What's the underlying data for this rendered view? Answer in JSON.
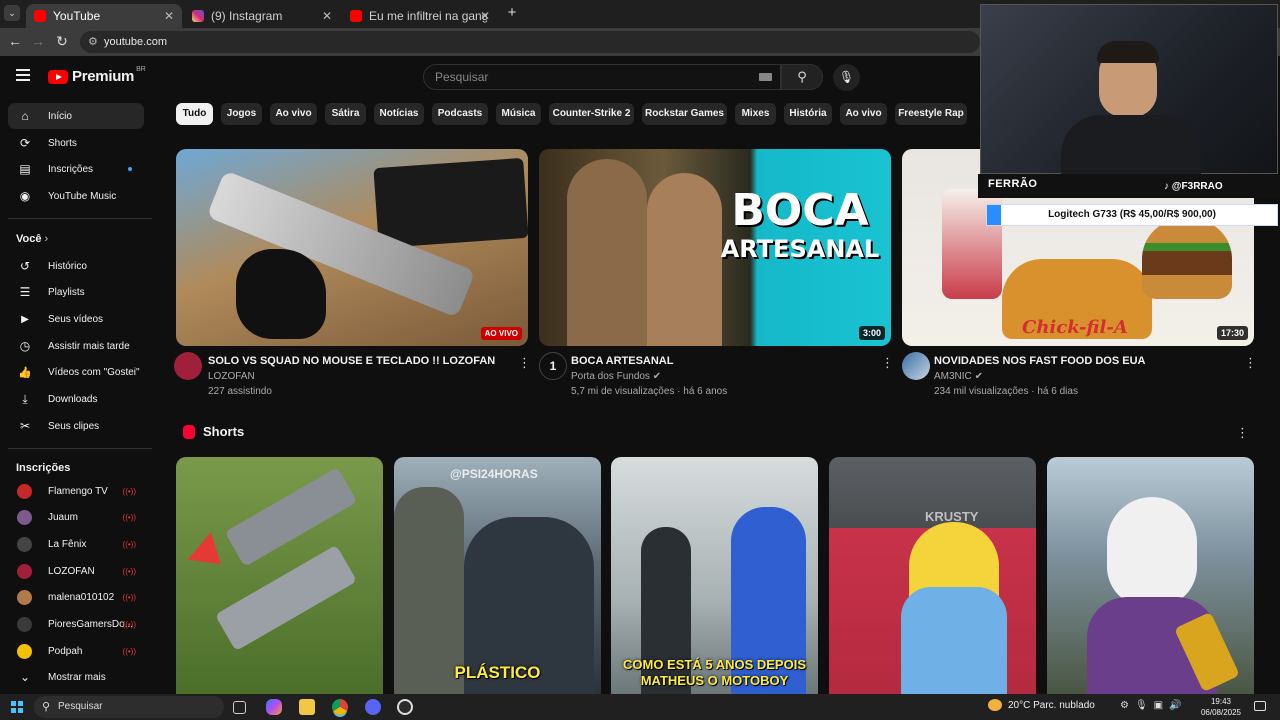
{
  "browser": {
    "tabs": [
      {
        "title": "YouTube",
        "color": "#ff0000"
      },
      {
        "title": "(9) Instagram",
        "color": "#d62976"
      },
      {
        "title": "Eu me infiltrei na gangue mais ...",
        "color": "#ff0000"
      }
    ],
    "new_tab": "+",
    "url": "youtube.com"
  },
  "header": {
    "logo": "Premium",
    "country": "BR",
    "search_placeholder": "Pesquisar"
  },
  "sidebar": {
    "main": [
      {
        "label": "Início",
        "icon": "home-icon",
        "glyph": "⌂"
      },
      {
        "label": "Shorts",
        "icon": "shorts-icon",
        "glyph": "⟳"
      },
      {
        "label": "Inscrições",
        "icon": "subscriptions-icon",
        "glyph": "▤"
      },
      {
        "label": "YouTube Music",
        "icon": "music-icon",
        "glyph": "◉"
      }
    ],
    "you_title": "Você",
    "you": [
      {
        "label": "Histórico",
        "icon": "history-icon",
        "glyph": "↺"
      },
      {
        "label": "Playlists",
        "icon": "playlists-icon",
        "glyph": "☰"
      },
      {
        "label": "Seus vídeos",
        "icon": "your-videos-icon",
        "glyph": "▶"
      },
      {
        "label": "Assistir mais tarde",
        "icon": "watch-later-icon",
        "glyph": "◷"
      },
      {
        "label": "Vídeos com \"Gostei\"",
        "icon": "like-icon",
        "glyph": "👍"
      },
      {
        "label": "Downloads",
        "icon": "download-icon",
        "glyph": "⤓"
      },
      {
        "label": "Seus clipes",
        "icon": "clips-icon",
        "glyph": "✂"
      }
    ],
    "subs_title": "Inscrições",
    "subs": [
      {
        "label": "Flamengo TV",
        "color": "#c62828"
      },
      {
        "label": "Juaum",
        "color": "#7b5a8c"
      },
      {
        "label": "La Fênix",
        "color": "#444444"
      },
      {
        "label": "LOZOFAN",
        "color": "#a0203c"
      },
      {
        "label": "malena010102",
        "color": "#b07a4a"
      },
      {
        "label": "PioresGamersDo...",
        "color": "#3a3a3a"
      },
      {
        "label": "Podpah",
        "color": "#f2c200"
      }
    ],
    "show_more": "Mostrar mais"
  },
  "chips": [
    "Tudo",
    "Jogos",
    "Ao vivo",
    "Sátira",
    "Notícias",
    "Podcasts",
    "Música",
    "Counter-Strike 2",
    "Rockstar Games",
    "Mixes",
    "História",
    "Ao vivo",
    "Freestyle Rap"
  ],
  "videos": [
    {
      "title": "SOLO VS SQUAD NO MOUSE E TECLADO !! LOZOFAN",
      "channel": "LOZOFAN",
      "meta": "227 assistindo",
      "badge": "AO VIVO",
      "thumb_text": ""
    },
    {
      "title": "BOCA ARTESANAL",
      "channel": "Porta dos Fundos",
      "meta": "5,7 mi de visualizações · há 6 anos",
      "badge": "3:00",
      "thumb_text": "BOCA",
      "thumb_text2": "ARTESANAL"
    },
    {
      "title": "NOVIDADES NOS FAST FOOD DOS EUA",
      "channel": "AM3NIC",
      "meta": "234 mil visualizações · há 6 dias",
      "badge": "17:30",
      "thumb_text": "Chick-fil-A"
    }
  ],
  "shorts": {
    "title": "Shorts",
    "items": [
      {
        "caption": "",
        "colors": [
          "#6f8f3a",
          "#3f5e22"
        ]
      },
      {
        "caption": "PLÁSTICO",
        "overlay": "@PSI24HORAS",
        "colors": [
          "#8a9aa6",
          "#2f3a44"
        ]
      },
      {
        "caption": "COMO ESTÁ 5 ANOS DEPOIS MATHEUS O MOTOBOY",
        "colors": [
          "#bfc6c8",
          "#5b6a6e"
        ]
      },
      {
        "caption": "",
        "overlay": "KRUSTY",
        "colors": [
          "#6a6d70",
          "#c8324a"
        ]
      },
      {
        "caption": "",
        "colors": [
          "#8fa6b6",
          "#3f4a3b"
        ]
      }
    ]
  },
  "overlay": {
    "streamer": "FERRÃO",
    "handle": "@F3RRAO",
    "prize": "Logitech G733 (R$ 45,00/R$ 900,00)"
  },
  "taskbar": {
    "search": "Pesquisar",
    "weather": "20°C  Parc. nublado",
    "time": "19:43",
    "date": "06/08/2025"
  }
}
